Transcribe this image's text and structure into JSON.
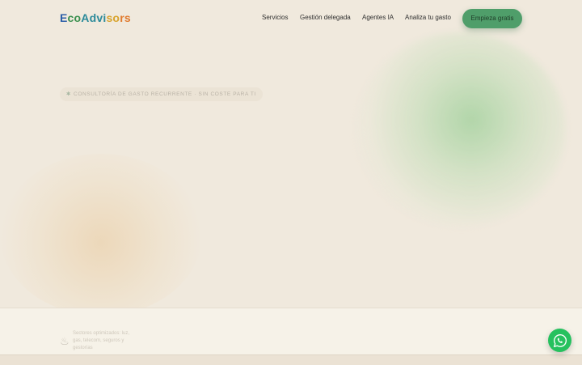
{
  "brand": {
    "logo_parts": [
      "E",
      "co",
      "Advi",
      "so",
      "rs"
    ]
  },
  "nav": {
    "links": [
      "Servicios",
      "Gestión delegada",
      "Agentes IA",
      "Analiza tu gasto"
    ],
    "cta_label": "Empieza gratis"
  },
  "hero": {
    "badge_dot": "✱",
    "badge_text": "CONSULTORÍA DE GASTO RECURRENTE · SIN COSTE PARA TI"
  },
  "stats": {
    "icon_glyph": "♨",
    "text": "Sectores optimizados: luz, gas, telecom, seguros y gestorías"
  },
  "colors": {
    "background": "#f0e9dd",
    "cta": "#4f9e6a",
    "whatsapp": "#25c15e"
  },
  "icons": {
    "whatsapp": "whatsapp-icon"
  }
}
